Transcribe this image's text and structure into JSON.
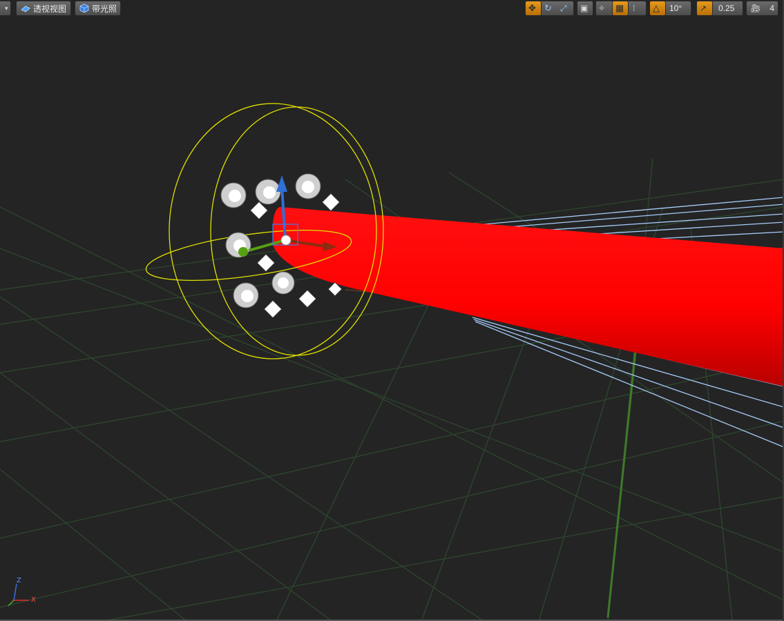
{
  "toolbar_left": {
    "view_mode_label": "透视视图",
    "lighting_label": "带光照"
  },
  "toolbar_right": {
    "rotation_snap_value": "10°",
    "scale_snap_value": "0.25",
    "camera_speed_value": "4"
  },
  "axis_gizmo": {
    "z": "Z",
    "x": "X"
  },
  "colors": {
    "beam": "#ff0000",
    "selection_wire": "#e6e600",
    "light_rays": "#9cc8ff",
    "grid": "#2f4a2f",
    "toolbar_accent": "#e0901a"
  },
  "icons": {
    "translate": "move-arrows-icon",
    "rotate": "rotate-icon",
    "scale": "scale-icon",
    "surface": "cube-icon",
    "grid_snap": "grid-icon",
    "angle_snap": "angle-icon",
    "scale_snap": "scale-arrow-icon",
    "camera": "camera-icon"
  }
}
